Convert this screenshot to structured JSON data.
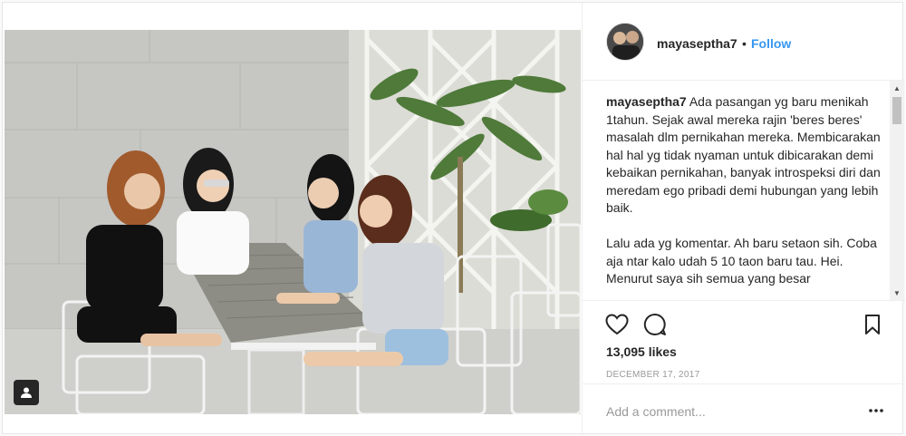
{
  "post": {
    "username": "mayaseptha7",
    "separator": "•",
    "follow_label": "Follow",
    "caption": {
      "username": "mayaseptha7",
      "paragraph1": "Ada pasangan yg baru menikah 1tahun. Sejak awal mereka rajin 'beres beres' masalah dlm pernikahan mereka. Membicarakan hal hal yg tidak nyaman untuk dibicarakan demi kebaikan pernikahan, banyak introspeksi diri dan meredam ego pribadi demi hubungan yang lebih baik.",
      "paragraph2": "Lalu ada yg komentar. Ah baru setaon sih. Coba aja ntar kalo udah 5 10 taon baru tau. Hei. Menurut saya sih semua yang besar"
    },
    "likes": "13,095 likes",
    "date": "DECEMBER 17, 2017",
    "comment_placeholder": "Add a comment..."
  },
  "icons": {
    "like": "heart-icon",
    "comment": "comment-icon",
    "save": "bookmark-icon",
    "more": "ellipsis-icon",
    "tagged_users": "user-tag-icon"
  },
  "colors": {
    "follow_blue": "#3897f0",
    "text": "#262626",
    "muted": "#999999"
  }
}
